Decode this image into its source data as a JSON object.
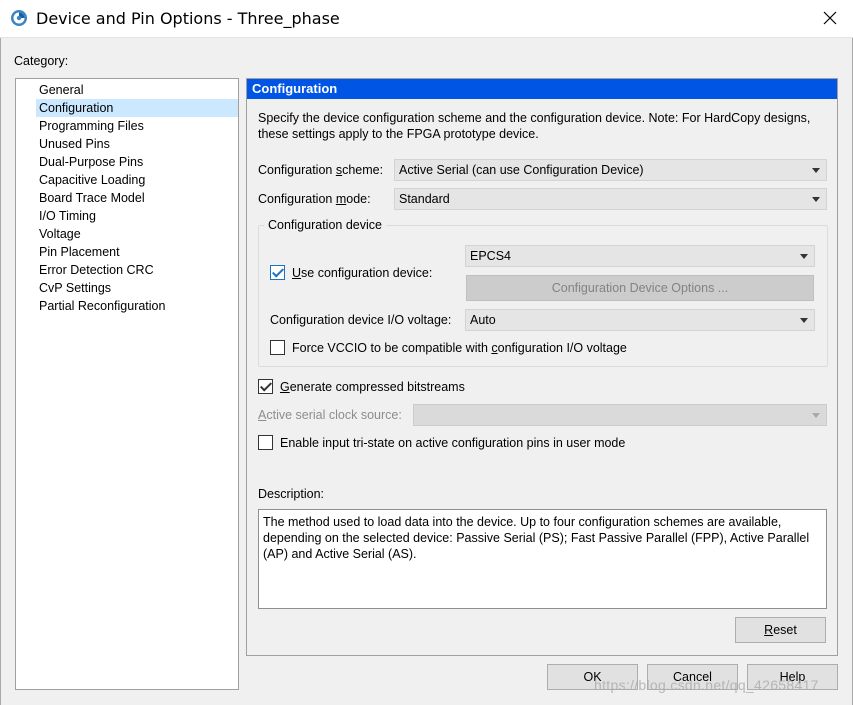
{
  "window": {
    "title": "Device and Pin Options - Three_phase"
  },
  "category": {
    "label": "Category:",
    "items": [
      {
        "label": "General"
      },
      {
        "label": "Configuration"
      },
      {
        "label": "Programming Files"
      },
      {
        "label": "Unused Pins"
      },
      {
        "label": "Dual-Purpose Pins"
      },
      {
        "label": "Capacitive Loading"
      },
      {
        "label": "Board Trace Model"
      },
      {
        "label": "I/O Timing"
      },
      {
        "label": "Voltage"
      },
      {
        "label": "Pin Placement"
      },
      {
        "label": "Error Detection CRC"
      },
      {
        "label": "CvP Settings"
      },
      {
        "label": "Partial Reconfiguration"
      }
    ],
    "selected": "Configuration"
  },
  "panel": {
    "header": "Configuration",
    "intro": "Specify the device configuration scheme and the configuration device. Note: For HardCopy designs, these settings apply to the FPGA prototype device.",
    "scheme": {
      "label_pre": "Configuration ",
      "label_ul": "s",
      "label_post": "cheme:",
      "value": "Active Serial (can use Configuration Device)"
    },
    "mode": {
      "label_pre": "Configuration ",
      "label_ul": "m",
      "label_post": "ode:",
      "value": "Standard"
    },
    "config_device": {
      "group_label": "Configuration device",
      "use_device_label_ul": "U",
      "use_device_label_post": "se configuration device:",
      "use_device_checked": true,
      "device_value": "EPCS4",
      "options_button": "Configuration Device Options ...",
      "io_voltage_label": "Configuration device I/O voltage:",
      "io_voltage_value": "Auto",
      "force_vccio_pre": "Force VCCIO to be compatible with ",
      "force_vccio_ul": "c",
      "force_vccio_post": "onfiguration I/O voltage",
      "force_vccio_checked": false
    },
    "compressed": {
      "label_ul": "G",
      "label_post": "enerate compressed bitstreams",
      "checked": true
    },
    "clock_source": {
      "label_ul": "A",
      "label_post": "ctive serial clock source:",
      "value": ""
    },
    "tristate": {
      "label": "Enable input tri-state on active configuration pins in user mode",
      "checked": false
    },
    "description": {
      "label": "Description:",
      "text": "The method used to load data into the device. Up to four configuration schemes are available, depending on the selected device: Passive Serial (PS); Fast Passive Parallel (FPP), Active Parallel (AP) and Active Serial (AS)."
    },
    "reset_ul": "R",
    "reset_post": "eset"
  },
  "footer": {
    "ok": "OK",
    "cancel": "Cancel",
    "help": "Help"
  },
  "watermark": "https://blog.csdn.net/qq_42658417",
  "colors": {
    "header_bg": "#0055e5",
    "selection_bg": "#cce8ff",
    "check_accent": "#1e6fc6"
  }
}
